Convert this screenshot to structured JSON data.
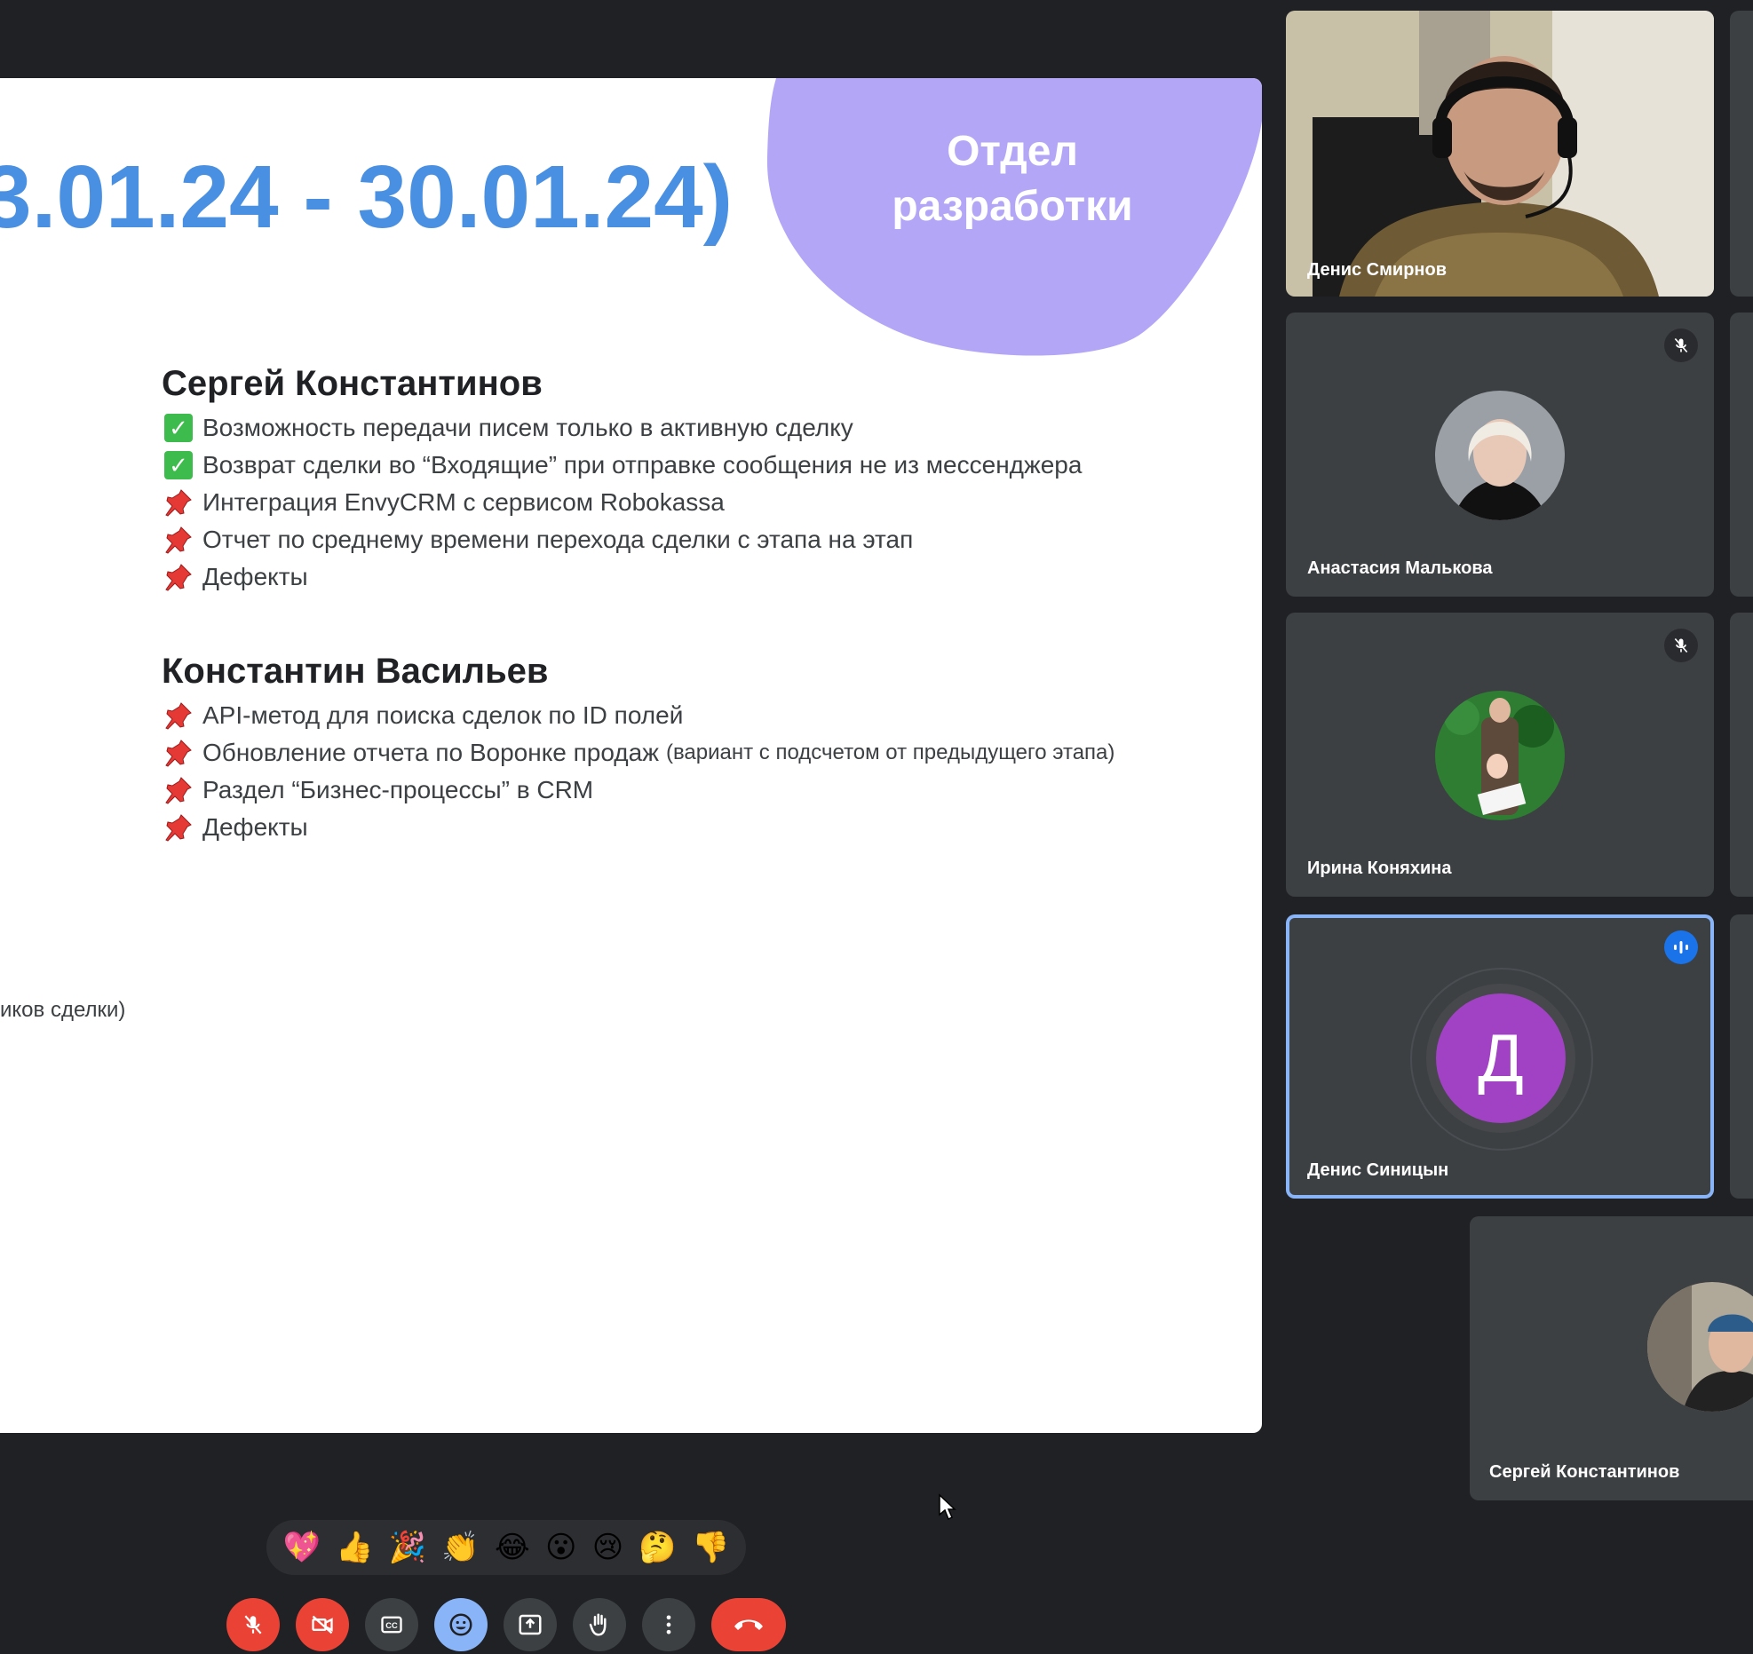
{
  "slide": {
    "title": "3.01.24 - 30.01.24)",
    "department": "Отдел разработки",
    "sections": [
      {
        "name": "Сергей Константинов",
        "tasks": [
          {
            "icon": "check-icon",
            "text": "Возможность передачи писем только в активную сделку"
          },
          {
            "icon": "check-icon",
            "text": "Возврат сделки во “Входящие” при отправке сообщения не из мессенджера"
          },
          {
            "icon": "pushpin-icon",
            "text": "Интеграция EnvyCRM с сервисом Robokassa"
          },
          {
            "icon": "pushpin-icon",
            "text": "Отчет по среднему времени перехода сделки с этапа на этап"
          },
          {
            "icon": "pushpin-icon",
            "text": "Дефекты"
          }
        ]
      },
      {
        "name": "Константин Васильев",
        "tasks": [
          {
            "icon": "pushpin-icon",
            "text": "API-метод для поиска сделок по ID полей"
          },
          {
            "icon": "pushpin-icon",
            "text": "Обновление отчета по Воронке продаж",
            "note": "(вариант с подсчетом от предыдущего этапа)"
          },
          {
            "icon": "pushpin-icon",
            "text": "Раздел “Бизнес-процессы” в CRM"
          },
          {
            "icon": "pushpin-icon",
            "text": "Дефекты"
          }
        ]
      }
    ],
    "stray_text": "иков сделки)"
  },
  "participants": [
    {
      "name": "Денис Смирнов",
      "state": "video"
    },
    {
      "name": "Анастасия Малькова",
      "state": "muted"
    },
    {
      "name": "Ирина Коняхина",
      "state": "muted"
    },
    {
      "name": "Денис Синицын",
      "state": "speaking",
      "initial": "Д",
      "avatar_color": "#a142c4"
    },
    {
      "name": "Сергей Константинов",
      "state": "avatar"
    }
  ],
  "reactions": [
    "💖",
    "👍",
    "🎉",
    "👏",
    "😂",
    "😮",
    "😢",
    "🤔",
    "👎"
  ],
  "controls": [
    {
      "name": "mic-off-icon",
      "color": "#ea4335"
    },
    {
      "name": "camera-off-icon",
      "color": "#ea4335"
    },
    {
      "name": "captions-icon",
      "color": "#3c4043"
    },
    {
      "name": "emoji-icon",
      "color": "#8ab4f8"
    },
    {
      "name": "present-icon",
      "color": "#3c4043"
    },
    {
      "name": "raise-hand-icon",
      "color": "#3c4043"
    },
    {
      "name": "more-options-icon",
      "color": "#3c4043"
    },
    {
      "name": "end-call-icon",
      "color": "#ea4335"
    }
  ],
  "colors": {
    "background": "#202124",
    "tile": "#3c4043",
    "title_blue": "#4a90e2",
    "blob_purple": "#b3a6f7",
    "speaking_border": "#8ab4f8"
  }
}
